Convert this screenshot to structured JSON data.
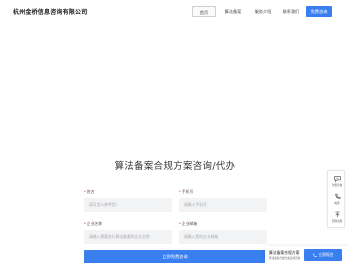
{
  "header": {
    "logo": "杭州金桥信息咨询有限公司",
    "nav": [
      {
        "label": "首页"
      },
      {
        "label": "算法备案"
      },
      {
        "label": "服务介绍"
      },
      {
        "label": "联系我们"
      }
    ],
    "cta": "免费咨询"
  },
  "form": {
    "title": "算法备案合规方案咨询/代办",
    "name_label": "姓名",
    "name_placeholder": "填写怎么称呼您?",
    "phone_label": "手机号",
    "phone_placeholder": "请输入手机号",
    "company_label": "企业名称",
    "company_placeholder": "请输入需要进行算法备案的企业名称",
    "email_label": "企业邮箱",
    "email_placeholder": "请输入您的企业邮箱",
    "submit": "立即免费咨询",
    "required_mark": "*"
  },
  "side_float": {
    "items": [
      {
        "label": "免费咨询",
        "icon": "chat-icon"
      },
      {
        "label": "电话",
        "icon": "phone-icon"
      },
      {
        "label": "回到顶部",
        "icon": "arrow-up-icon"
      }
    ]
  },
  "bottom_bar": {
    "title": "算法备案合规方案",
    "subtitle": "算法备案合规方案定制咨询",
    "button": "立即报名"
  },
  "colors": {
    "accent": "#3a7ff0",
    "required": "#e33333",
    "field_bg": "#f2f3f5"
  }
}
